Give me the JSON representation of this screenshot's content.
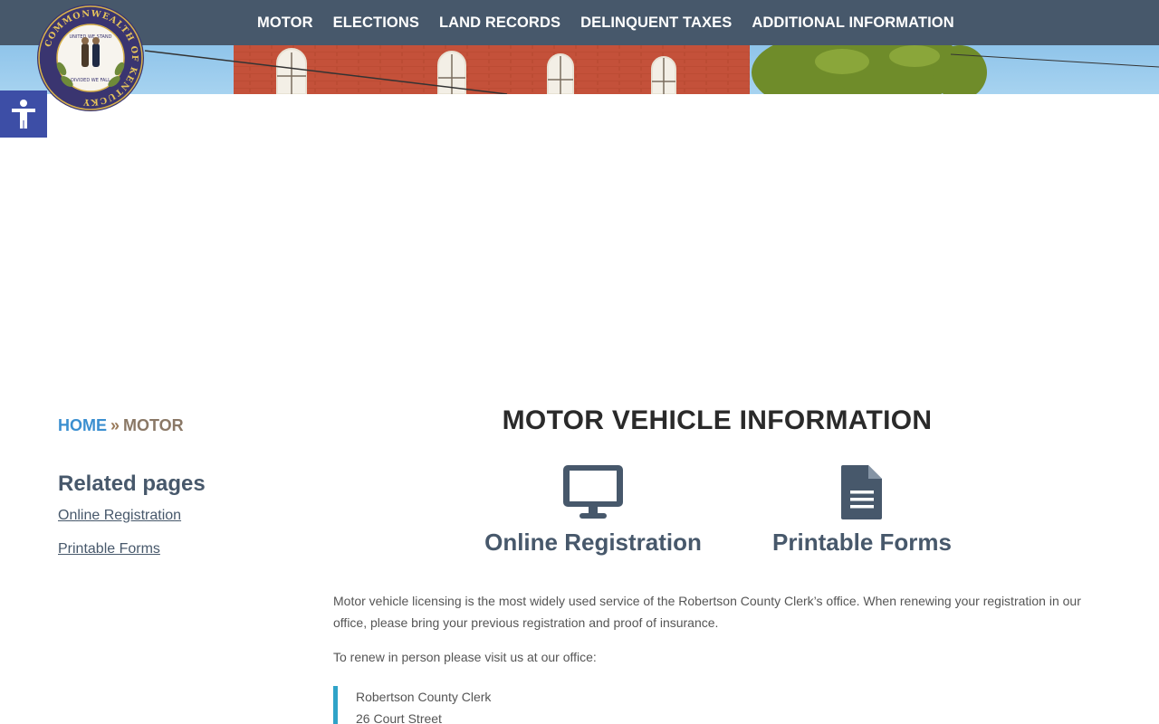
{
  "nav": {
    "items": [
      "MOTOR",
      "ELECTIONS",
      "LAND RECORDS",
      "DELINQUENT TAXES",
      "ADDITIONAL INFORMATION"
    ]
  },
  "seal": {
    "ring_text": "COMMONWEALTH OF KENTUCKY",
    "top_text": "UNITED WE STAND",
    "bottom_text": "DIVIDED WE FALL"
  },
  "breadcrumb": {
    "home": "HOME",
    "separator": "»",
    "current": "MOTOR"
  },
  "sidebar": {
    "title": "Related pages",
    "links": [
      "Online Registration",
      "Printable Forms"
    ]
  },
  "main": {
    "title": "MOTOR VEHICLE INFORMATION",
    "cards": [
      {
        "label": "Online Registration",
        "icon": "monitor-icon"
      },
      {
        "label": "Printable Forms",
        "icon": "document-icon"
      }
    ],
    "paragraphs": [
      "Motor vehicle licensing is the most widely used service of the Robertson County Clerk’s office. When renewing your registration in our office, please bring your previous registration and proof of insurance.",
      "To renew in person please visit us at our office:"
    ],
    "address": [
      "Robertson County Clerk",
      "26 Court Street"
    ]
  },
  "colors": {
    "nav_bg": "#47586b",
    "accent_blue": "#3b8fd0",
    "accessibility_bg": "#3d4ea6",
    "quote_bar": "#2fa3c8"
  }
}
